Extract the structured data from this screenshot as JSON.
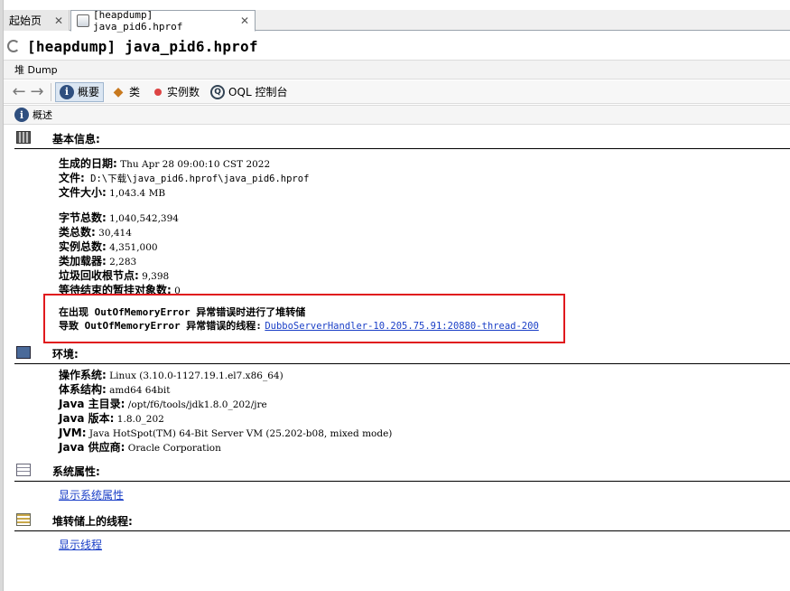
{
  "tabs": [
    {
      "label": "起始页",
      "close": "✕"
    },
    {
      "label": "[heapdump] java_pid6.hprof",
      "close": "✕"
    }
  ],
  "title": "[heapdump] java_pid6.hprof",
  "heap_bar_label": "堆 Dump",
  "toolbar": {
    "back": "←",
    "forward": "→",
    "summary": "概要",
    "classes": "类",
    "instances": "实例数",
    "oql": "OQL 控制台",
    "oql_icon_text": "Q"
  },
  "overview_label": "概述",
  "basic": {
    "heading": "基本信息:",
    "rows": [
      {
        "label": "生成的日期:",
        "value": " Thu Apr 28 09:00:10 CST 2022"
      },
      {
        "label": "文件:",
        "value": " D:\\下载\\java_pid6.hprof\\java_pid6.hprof"
      },
      {
        "label": "文件大小:",
        "value": " 1,043.4 MB"
      }
    ],
    "stats": [
      {
        "label": "字节总数:",
        "value": " 1,040,542,394"
      },
      {
        "label": "类总数:",
        "value": " 30,414"
      },
      {
        "label": "实例总数:",
        "value": " 4,351,000"
      },
      {
        "label": "类加载器:",
        "value": " 2,283"
      },
      {
        "label": "垃圾回收根节点:",
        "value": " 9,398"
      },
      {
        "label": "等待结束的暂挂对象数:",
        "value": " 0"
      }
    ],
    "oom_line1": "在出现 OutOfMemoryError 异常错误时进行了堆转储",
    "oom_line2_label": "导致 OutOfMemoryError 异常错误的线程:",
    "oom_thread_link": "DubboServerHandler-10.205.75.91:20880-thread-200"
  },
  "env": {
    "heading": "环境:",
    "rows": [
      {
        "label": "操作系统:",
        "value": " Linux (3.10.0-1127.19.1.el7.x86_64)"
      },
      {
        "label": "体系结构:",
        "value": " amd64 64bit"
      },
      {
        "label": "Java 主目录:",
        "value": " /opt/f6/tools/jdk1.8.0_202/jre"
      },
      {
        "label": "Java 版本:",
        "value": " 1.8.0_202"
      },
      {
        "label": "JVM:",
        "value": " Java HotSpot(TM) 64-Bit Server VM (25.202-b08, mixed mode)"
      },
      {
        "label": "Java 供应商:",
        "value": " Oracle Corporation"
      }
    ]
  },
  "sysprops": {
    "heading": "系统属性:",
    "link": "显示系统属性"
  },
  "threads": {
    "heading": "堆转储上的线程:",
    "link": "显示线程"
  }
}
